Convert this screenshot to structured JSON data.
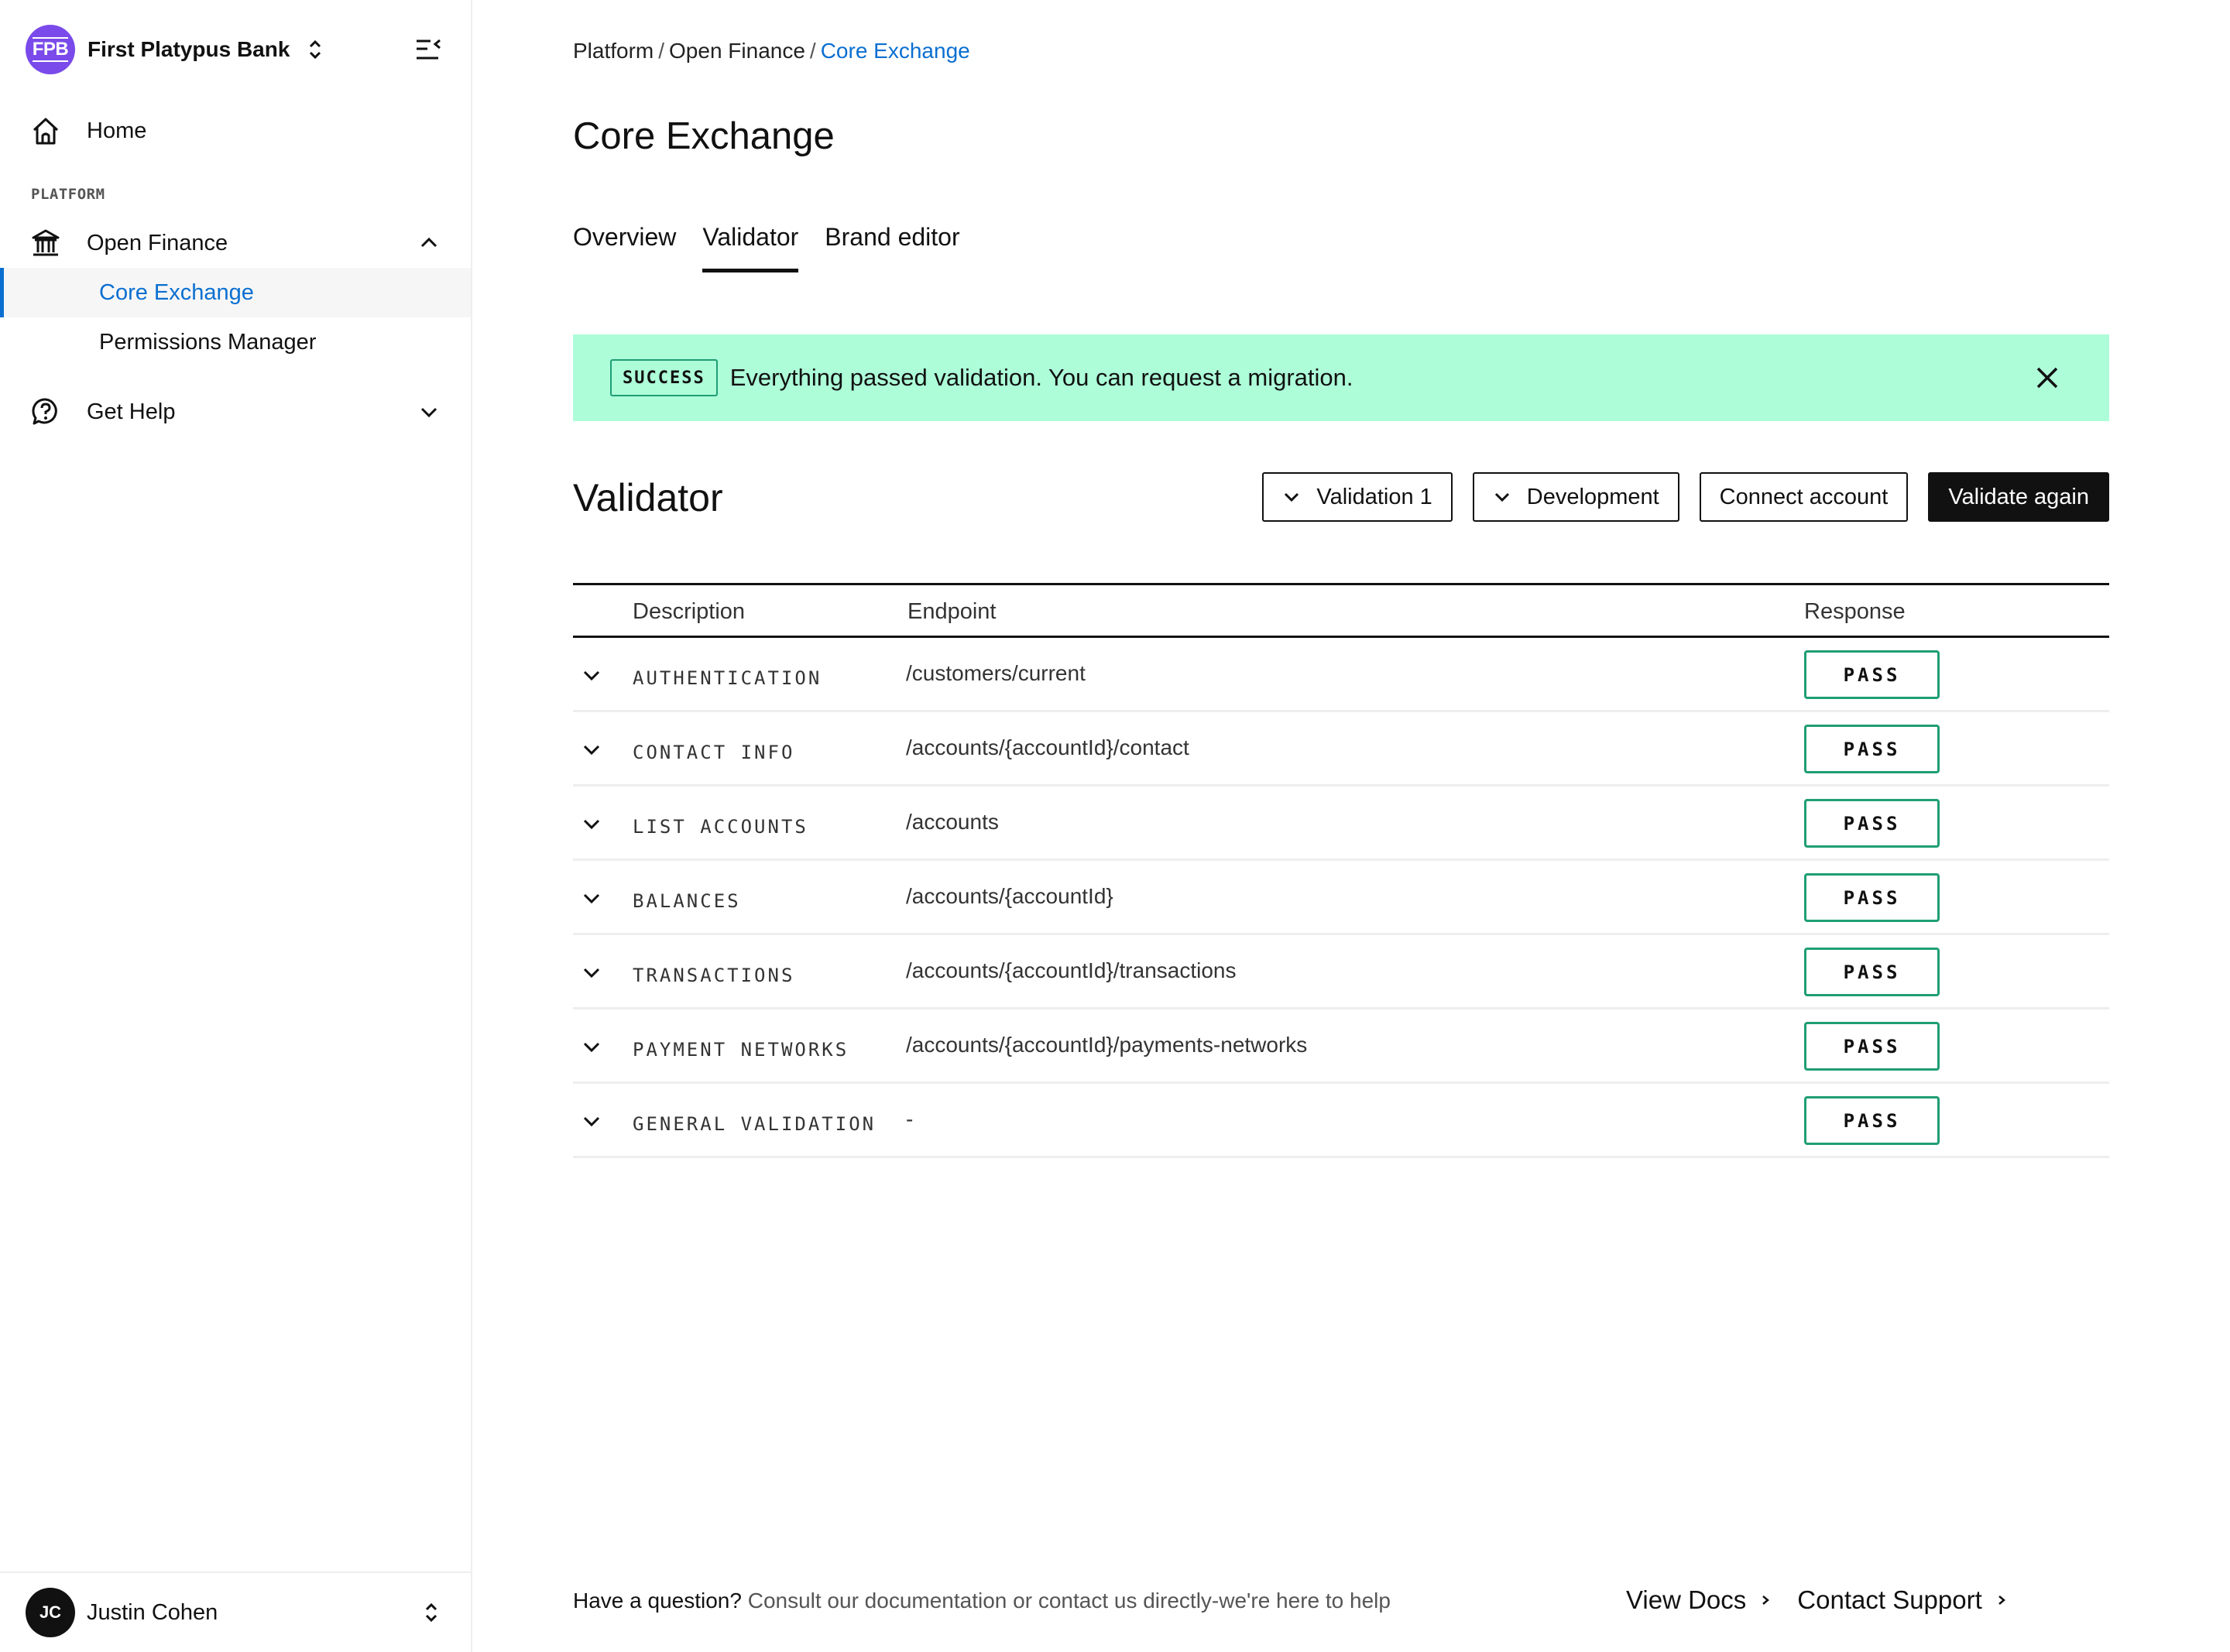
{
  "sidebar": {
    "org": {
      "initials": "FPB",
      "name": "First Platypus Bank",
      "logo_color": "#7a4aea"
    },
    "items": {
      "home": {
        "label": "Home",
        "icon": "home-icon"
      },
      "section_label": "PLATFORM",
      "open_finance": {
        "label": "Open Finance",
        "icon": "bank-icon",
        "expanded": true
      },
      "sub_items": [
        {
          "label": "Core Exchange",
          "active": true
        },
        {
          "label": "Permissions Manager",
          "active": false
        }
      ],
      "get_help": {
        "label": "Get Help",
        "icon": "help-chat-icon",
        "expanded": false
      }
    },
    "user": {
      "initials": "JC",
      "name": "Justin Cohen"
    }
  },
  "breadcrumb": {
    "items": [
      "Platform",
      "Open Finance"
    ],
    "current": "Core Exchange",
    "separator": "/"
  },
  "page": {
    "title": "Core Exchange"
  },
  "tabs": [
    {
      "label": "Overview",
      "active": false
    },
    {
      "label": "Validator",
      "active": true
    },
    {
      "label": "Brand editor",
      "active": false
    }
  ],
  "banner": {
    "badge": "SUCCESS",
    "message": "Everything passed validation. You can request a migration.",
    "background": "#adfdd9"
  },
  "validator": {
    "heading": "Validator",
    "actions": {
      "validation_select": "Validation 1",
      "environment_select": "Development",
      "connect_account": "Connect account",
      "validate_again": "Validate again"
    },
    "table": {
      "headers": {
        "description": "Description",
        "endpoint": "Endpoint",
        "response": "Response"
      },
      "rows": [
        {
          "description": "AUTHENTICATION",
          "endpoint": "/customers/current",
          "response": "PASS"
        },
        {
          "description": "CONTACT INFO",
          "endpoint": "/accounts/{accountId}/contact",
          "response": "PASS"
        },
        {
          "description": "LIST ACCOUNTS",
          "endpoint": "/accounts",
          "response": "PASS"
        },
        {
          "description": "BALANCES",
          "endpoint": "/accounts/{accountId}",
          "response": "PASS"
        },
        {
          "description": "TRANSACTIONS",
          "endpoint": "/accounts/{accountId}/transactions",
          "response": "PASS"
        },
        {
          "description": "PAYMENT NETWORKS",
          "endpoint": "/accounts/{accountId}/payments-networks",
          "response": "PASS"
        },
        {
          "description": "GENERAL VALIDATION",
          "endpoint": "-",
          "response": "PASS"
        }
      ],
      "pass_color": "#1f9e74"
    }
  },
  "footer": {
    "question": "Have a question?",
    "text": "Consult our documentation or contact us directly-we're here to help",
    "links": [
      "View Docs",
      "Contact Support"
    ]
  },
  "colors": {
    "accent": "#0a6fd1",
    "text": "#111111"
  }
}
